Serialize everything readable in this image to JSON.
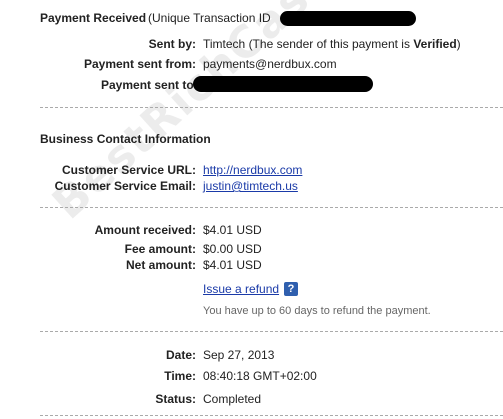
{
  "header": {
    "title": "Payment Received",
    "transaction_prefix": "(Unique Transaction ID"
  },
  "sender": {
    "sent_by_label": "Sent by:",
    "sent_by_value": "Timtech (The sender of this payment is ",
    "verified": "Verified",
    "close_paren": ")",
    "from_label": "Payment sent from:",
    "from_value": "payments@nerdbux.com",
    "to_label": "Payment sent to:"
  },
  "business": {
    "heading": "Business Contact Information",
    "url_label": "Customer Service URL:",
    "url_value": "http://nerdbux.com",
    "email_label": "Customer Service Email:",
    "email_value": "justin@timtech.us"
  },
  "amounts": {
    "received_label": "Amount received:",
    "received_value": "$4.01 USD",
    "fee_label": "Fee amount:",
    "fee_value": "$0.00 USD",
    "net_label": "Net amount:",
    "net_value": "$4.01 USD",
    "refund_link": "Issue a refund",
    "refund_note": "You have up to 60 days to refund the payment."
  },
  "details": {
    "date_label": "Date:",
    "date_value": "Sep 27, 2013",
    "time_label": "Time:",
    "time_value": "08:40:18 GMT+02:00",
    "status_label": "Status:",
    "status_value": "Completed"
  },
  "watermark": "BestRichCashFU4U.com",
  "icons": {
    "help": "question-icon"
  }
}
